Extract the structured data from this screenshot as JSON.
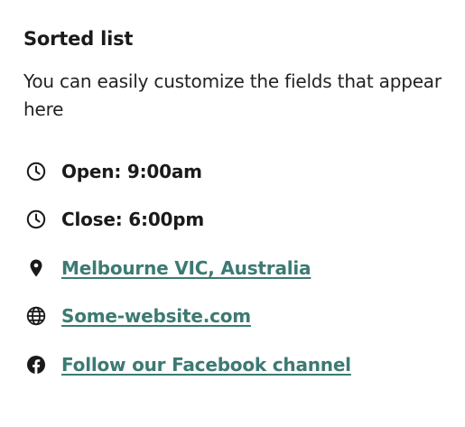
{
  "card": {
    "title": "Sorted list",
    "description": "You can easily customize the fields that appear here"
  },
  "items": [
    {
      "icon": "clock-icon",
      "label": "Open: 9:00am",
      "is_link": false
    },
    {
      "icon": "clock-icon",
      "label": "Close: 6:00pm",
      "is_link": false
    },
    {
      "icon": "map-pin-icon",
      "label": "Melbourne VIC, Australia",
      "is_link": true
    },
    {
      "icon": "globe-icon",
      "label": "Some-website.com",
      "is_link": true
    },
    {
      "icon": "facebook-icon",
      "label": "Follow our Facebook channel",
      "is_link": true
    }
  ],
  "colors": {
    "text": "#1a1a1a",
    "link": "#3c7a73",
    "background": "#ffffff"
  }
}
